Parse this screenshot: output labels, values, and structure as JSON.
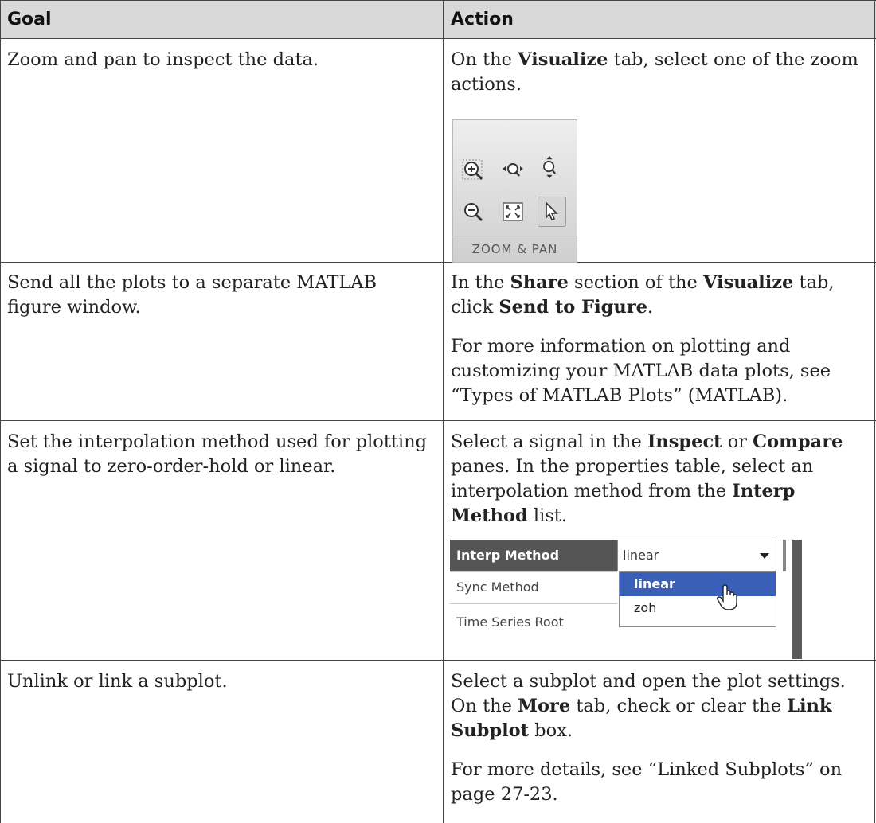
{
  "header": {
    "goal": "Goal",
    "action": "Action"
  },
  "rows": [
    {
      "goal": "Zoom and pan to inspect the data.",
      "action": [
        {
          "t": "On the "
        },
        {
          "b": "Visualize"
        },
        {
          "t": " tab, select one of the zoom actions."
        }
      ]
    },
    {
      "goal": "Send all the plots to a separate MATLAB figure window.",
      "action_p1": [
        {
          "t": "In the "
        },
        {
          "b": "Share"
        },
        {
          "t": " section of the "
        },
        {
          "b": "Visualize"
        },
        {
          "t": " tab, click "
        },
        {
          "b": "Send to Figure"
        },
        {
          "t": "."
        }
      ],
      "action_p2": "For more information on plotting and customizing your MATLAB data plots, see “Types of MATLAB Plots” (MATLAB)."
    },
    {
      "goal": "Set the interpolation method used for plotting a signal to zero-order-hold or linear.",
      "action": [
        {
          "t": "Select a signal in the "
        },
        {
          "b": "Inspect"
        },
        {
          "t": " or "
        },
        {
          "b": "Compare"
        },
        {
          "t": " panes. In the properties table, select an interpolation method from the "
        },
        {
          "b": "Interp Method"
        },
        {
          "t": " list."
        }
      ]
    },
    {
      "goal": "Unlink or link a subplot.",
      "action_p1": [
        {
          "t": "Select a subplot and open the plot settings. On the "
        },
        {
          "b": "More"
        },
        {
          "t": " tab, check or clear the "
        },
        {
          "b": "Link Subplot"
        },
        {
          "t": " box."
        }
      ],
      "action_p2": "For more details, see “Linked Subplots” on page 27-23."
    }
  ],
  "zoom_widget": {
    "label": "ZOOM & PAN",
    "icons": [
      "zoom-in-icon",
      "zoom-horizontal-icon",
      "zoom-vertical-icon",
      "zoom-out-icon",
      "fit-to-view-icon",
      "cursor-icon"
    ]
  },
  "props_widget": {
    "rows": [
      "Interp Method",
      "Sync Method",
      "Time Series Root"
    ],
    "dropdown_value": "linear",
    "options": [
      "linear",
      "zoh"
    ],
    "highlight_color": "#3a5fb8"
  }
}
